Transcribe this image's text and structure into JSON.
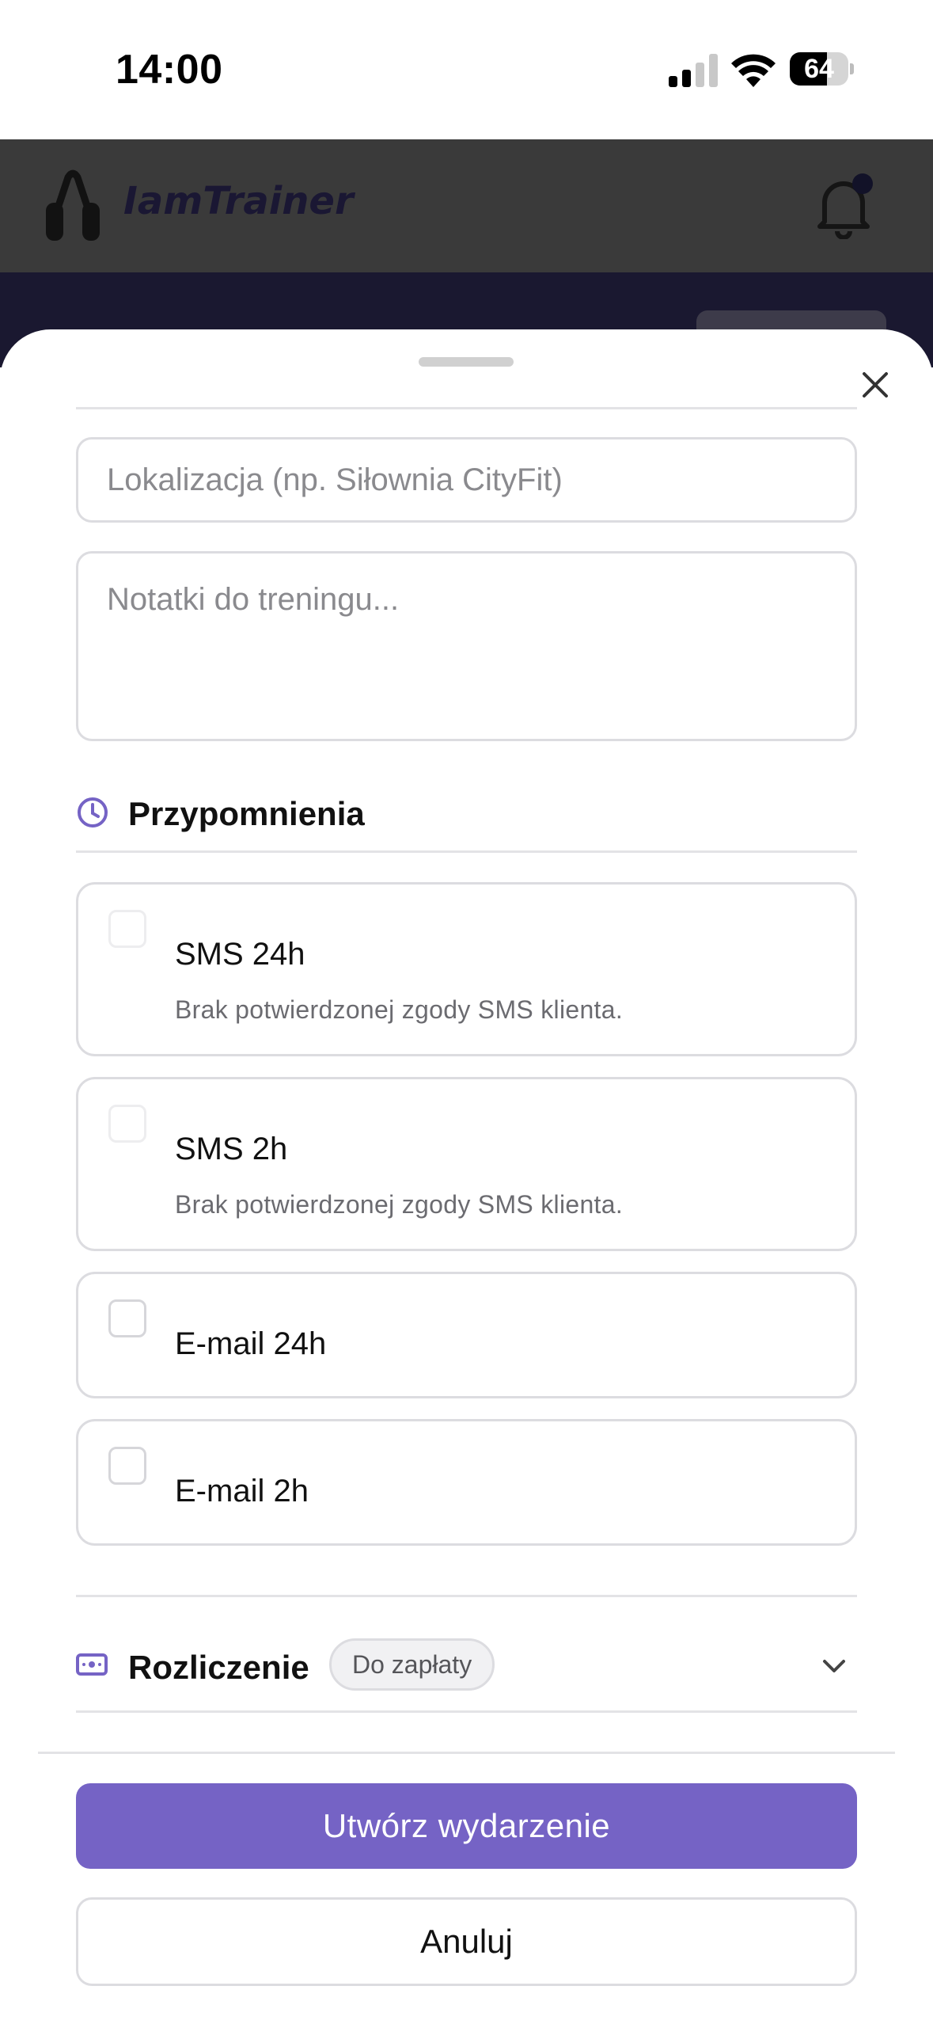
{
  "status_bar": {
    "time": "14:00",
    "battery": "64",
    "battery_level": 0.64,
    "icons": [
      "signal-icon",
      "wifi-icon",
      "battery-icon"
    ]
  },
  "app_header": {
    "app_name": "IamTrainer",
    "logo_icon": "hand-grip-icon",
    "notification_icon": "bell-icon",
    "has_unread_dot": true
  },
  "sheet": {
    "close_icon": "close-icon",
    "location_placeholder": "Lokalizacja (np. Siłownia CityFit)",
    "notes_placeholder": "Notatki do treningu...",
    "reminders": {
      "title": "Przypomnienia",
      "icon": "clock-icon",
      "items": [
        {
          "label": "SMS 24h",
          "note": "Brak potwierdzonej zgody SMS klienta.",
          "disabled": true,
          "checked": false
        },
        {
          "label": "SMS 2h",
          "note": "Brak potwierdzonej zgody SMS klienta.",
          "disabled": true,
          "checked": false
        },
        {
          "label": "E-mail 24h",
          "note": "",
          "disabled": false,
          "checked": false
        },
        {
          "label": "E-mail 2h",
          "note": "",
          "disabled": false,
          "checked": false
        }
      ]
    },
    "billing": {
      "title": "Rozliczenie",
      "icon": "banknote-icon",
      "badge": "Do zapłaty",
      "expand_icon": "chevron-down-icon"
    },
    "primary_button": "Utwórz wydarzenie",
    "secondary_button": "Anuluj"
  },
  "colors": {
    "accent": "#7563c5",
    "border": "#dcdce0",
    "muted_text": "#6b6b70"
  }
}
